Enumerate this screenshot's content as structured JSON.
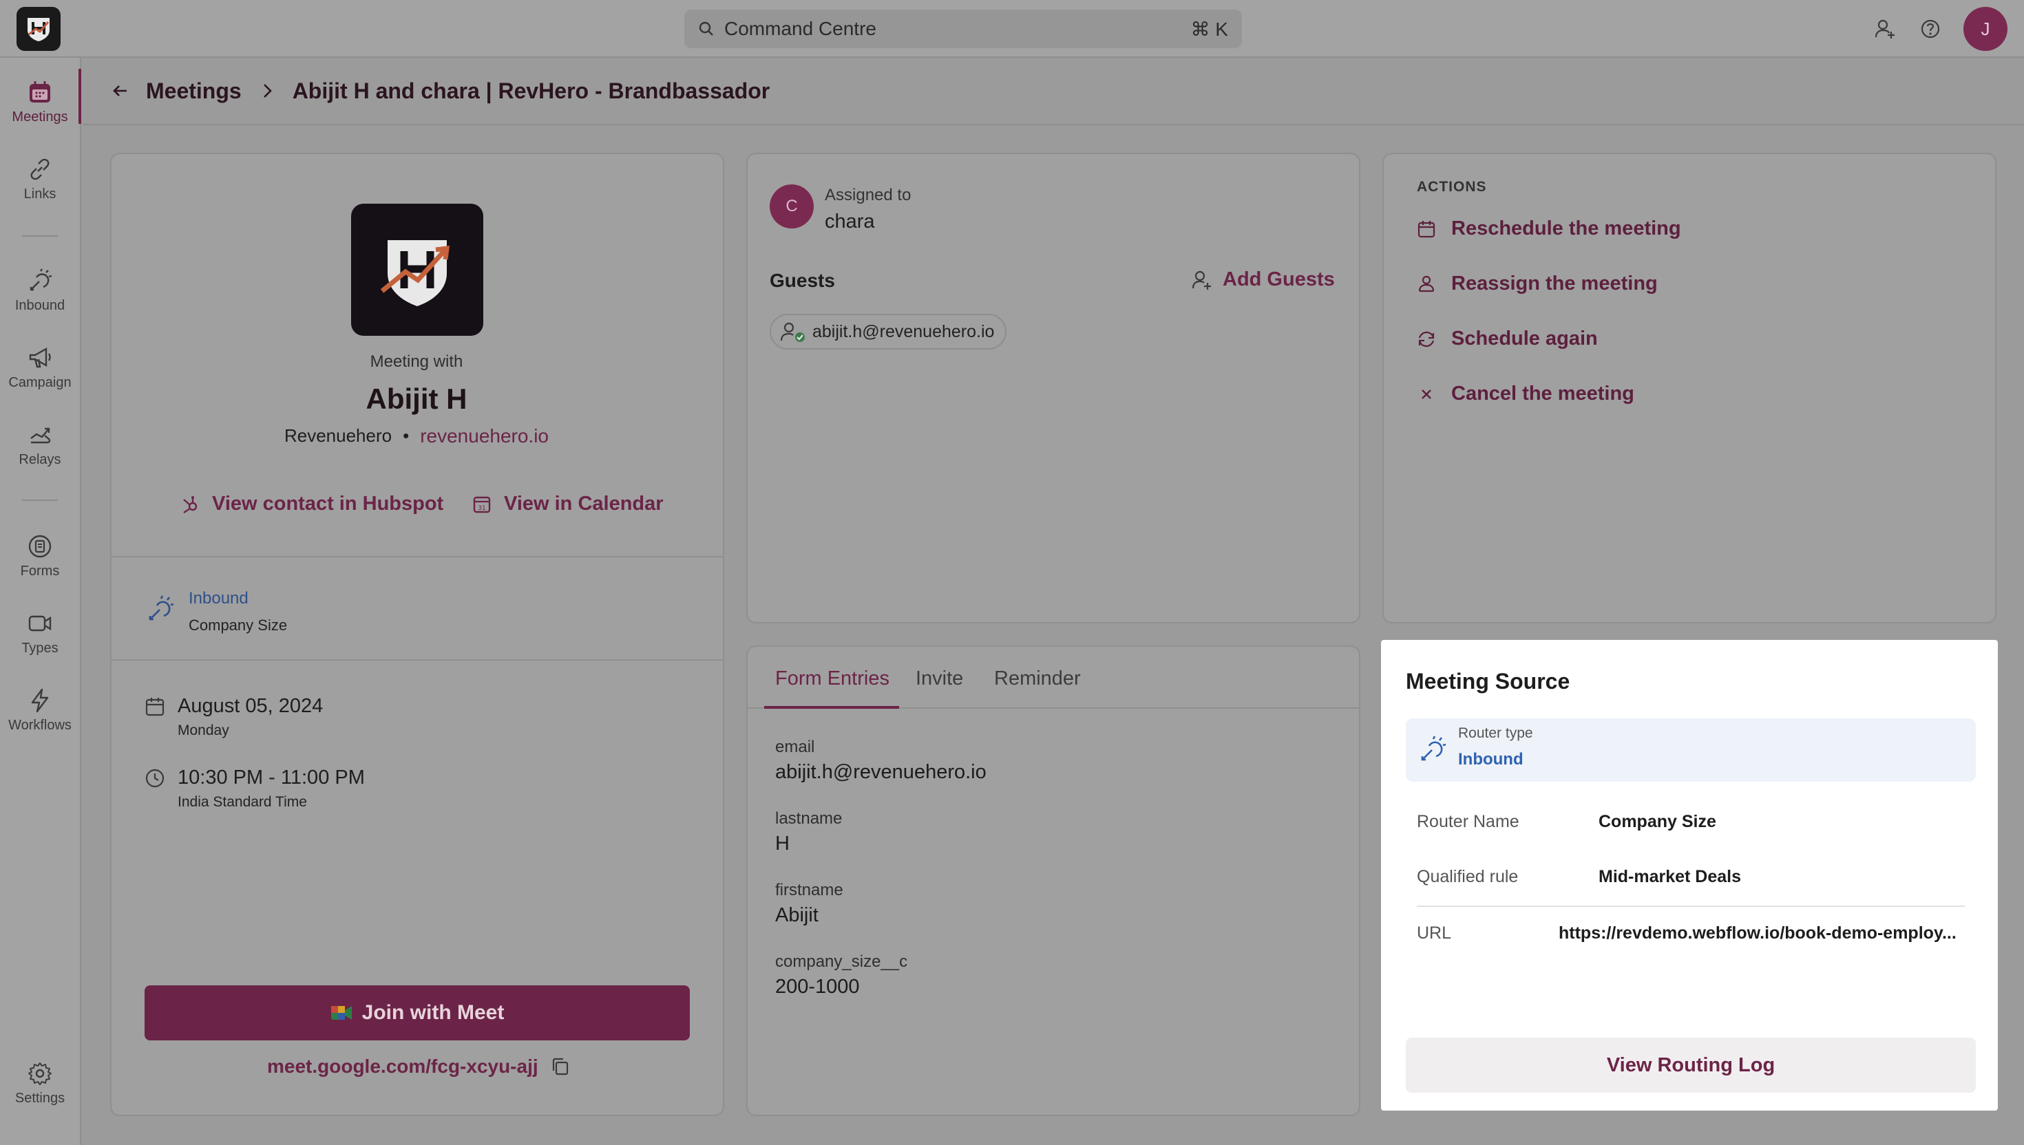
{
  "search": {
    "placeholder": "Command Centre",
    "shortcut": "⌘ K"
  },
  "user": {
    "initial": "J"
  },
  "sidebar": {
    "items": [
      {
        "label": "Meetings",
        "icon": "calendar-icon"
      },
      {
        "label": "Links",
        "icon": "link-icon"
      },
      {
        "label": "Inbound",
        "icon": "inbound-icon"
      },
      {
        "label": "Campaign",
        "icon": "megaphone-icon"
      },
      {
        "label": "Relays",
        "icon": "relay-icon"
      },
      {
        "label": "Forms",
        "icon": "form-icon"
      },
      {
        "label": "Types",
        "icon": "video-icon"
      },
      {
        "label": "Workflows",
        "icon": "lightning-icon"
      },
      {
        "label": "Settings",
        "icon": "gear-icon"
      }
    ]
  },
  "breadcrumb": {
    "parent": "Meetings",
    "current": "Abijit H and chara | RevHero -  Brandbassador"
  },
  "meeting": {
    "with_label": "Meeting with",
    "name": "Abijit H",
    "company": "Revenuehero",
    "separator": "•",
    "domain": "revenuehero.io",
    "view_hubspot": "View contact in Hubspot",
    "view_calendar": "View in Calendar",
    "source_type": "Inbound",
    "source_name": "Company Size",
    "date": "August 05, 2024",
    "weekday": "Monday",
    "time": "10:30 PM - 11:00 PM",
    "timezone": "India Standard Time",
    "join_label": "Join with Meet",
    "meet_link": "meet.google.com/fcg-xcyu-ajj"
  },
  "assignment": {
    "avatar_initial": "C",
    "assigned_label": "Assigned to",
    "assignee": "chara",
    "guests_label": "Guests",
    "add_guests": "Add Guests",
    "guests": [
      "abijit.h@revenuehero.io"
    ]
  },
  "tabs": [
    "Form Entries",
    "Invite",
    "Reminder"
  ],
  "form_entries": [
    {
      "label": "email",
      "value": "abijit.h@revenuehero.io"
    },
    {
      "label": "lastname",
      "value": "H"
    },
    {
      "label": "firstname",
      "value": "Abijit"
    },
    {
      "label": "company_size__c",
      "value": "200-1000"
    }
  ],
  "actions": {
    "title": "ACTIONS",
    "items": [
      {
        "label": "Reschedule the meeting",
        "icon": "calendar-icon"
      },
      {
        "label": "Reassign the meeting",
        "icon": "user-swap-icon"
      },
      {
        "label": "Schedule again",
        "icon": "refresh-icon"
      },
      {
        "label": "Cancel the meeting",
        "icon": "close-icon"
      }
    ]
  },
  "meeting_source": {
    "title": "Meeting Source",
    "router_type_label": "Router type",
    "router_type": "Inbound",
    "router_name_label": "Router Name",
    "router_name": "Company Size",
    "qualified_rule_label": "Qualified rule",
    "qualified_rule": "Mid-market Deals",
    "url_label": "URL",
    "url": "https://revdemo.webflow.io/book-demo-employ...",
    "button": "View Routing Log"
  },
  "colors": {
    "accent": "#6b2447",
    "link_blue": "#2e4f8a",
    "overlay_gray": "#9b9b9b"
  }
}
